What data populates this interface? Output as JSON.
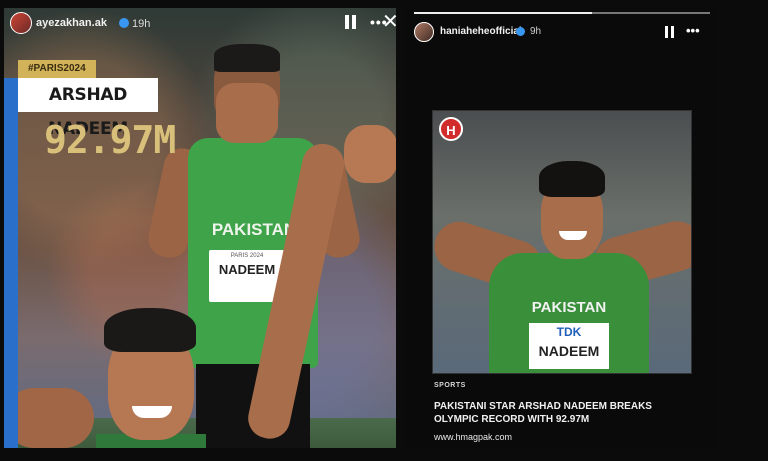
{
  "left_story": {
    "username": "ayezakhan.ak",
    "time": "19h",
    "tag": "#PARIS2024",
    "athlete_name": "ARSHAD NADEEM",
    "result": "92.97M",
    "jersey_text": "PAKISTAN",
    "bib_small": "PARIS 2024",
    "bib_name": "NADEEM"
  },
  "right_story": {
    "username": "haniaheheofficial",
    "time": "9h",
    "progress": 0.6,
    "logo_letter": "H",
    "jersey_text": "PAKISTAN",
    "bib_brand": "TDK",
    "bib_name": "NADEEM",
    "category": "SPORTS",
    "headline": "PAKISTANI STAR ARSHAD NADEEM BREAKS OLYMPIC RECORD WITH 92.97M",
    "url": "www.hmagpak.com"
  },
  "icons": {
    "pause": "pause-icon",
    "more": "more-options-icon",
    "close": "close-icon",
    "verified": "verified-badge-icon"
  }
}
